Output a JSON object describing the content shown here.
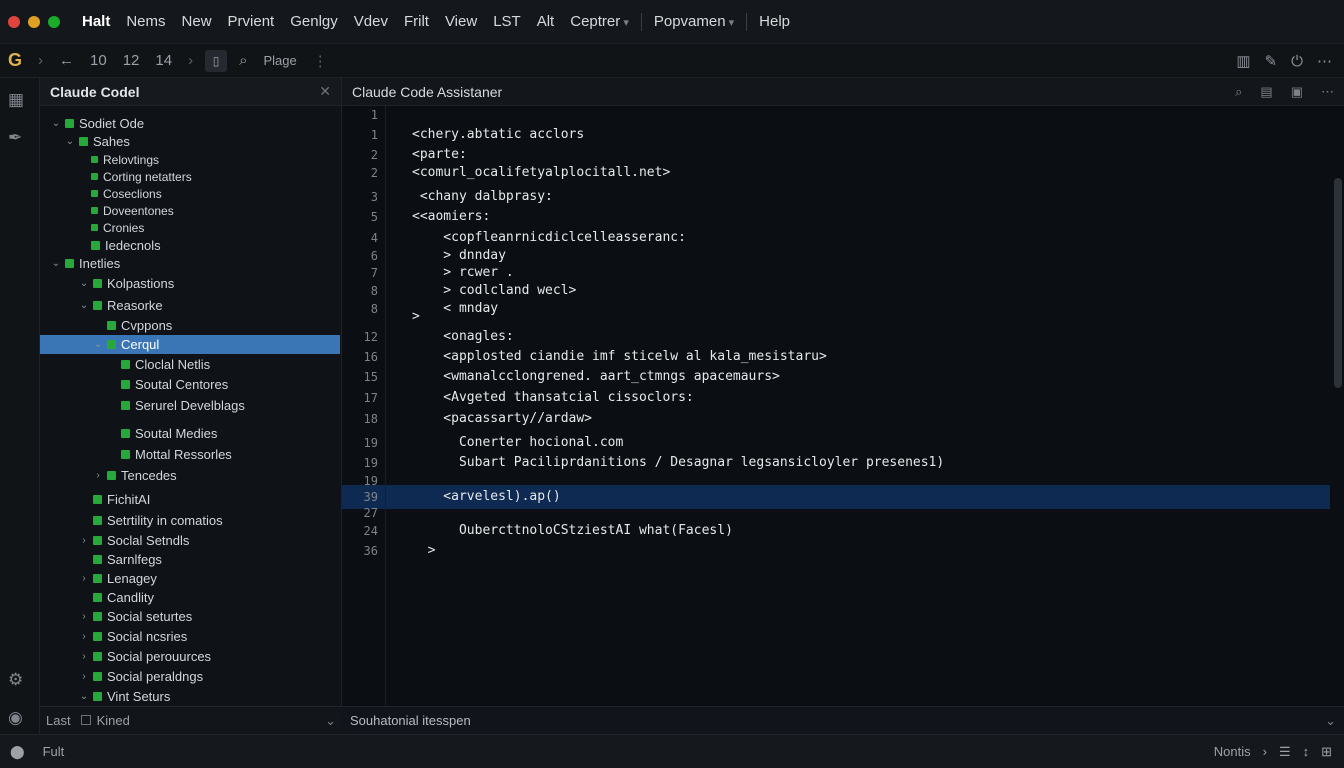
{
  "menubar": {
    "colors": {
      "close": "#e0443e",
      "minimize": "#dea123",
      "zoom": "#1aab29"
    },
    "items": [
      "Halt",
      "Nems",
      "New",
      "Prvient",
      "Genlgy",
      "Vdev",
      "Frilt",
      "View",
      "LST",
      "Alt",
      "Ceptrer",
      "Popvamen",
      "Help"
    ]
  },
  "toolbar": {
    "logo": "G",
    "nav_numbers": [
      "10",
      "12",
      "14"
    ],
    "page_label": "Plage",
    "icons": [
      "chevron-right-icon",
      "back-arrow-icon",
      "forward-arrow-icon",
      "document-icon",
      "search-icon",
      "more-icon",
      "columns-icon",
      "brush-icon",
      "power-icon",
      "ellipsis-icon"
    ]
  },
  "activity": {
    "icons": [
      "grid-icon",
      "pen-icon",
      "settings-icon",
      "account-icon"
    ]
  },
  "explorer": {
    "title": "Claude Codel",
    "rows": [
      {
        "label": "Sodiet Ode",
        "chev": "v"
      },
      {
        "label": "Sahes",
        "chev": "v"
      },
      {
        "label": "Relovtings",
        "chev": ""
      },
      {
        "label": "Corting netatters",
        "chev": ""
      },
      {
        "label": "Coseclions",
        "chev": ""
      },
      {
        "label": "Doveentones",
        "chev": ""
      },
      {
        "label": "Cronies",
        "chev": ""
      },
      {
        "label": "Iedecnols",
        "chev": ""
      },
      {
        "label": "Inetlies",
        "chev": "v"
      },
      {
        "label": "Kolpastions",
        "chev": "v"
      },
      {
        "label": "Reasorke",
        "chev": "v"
      },
      {
        "label": "Cvppons",
        "chev": ""
      },
      {
        "label": "Cerqul",
        "chev": "v"
      },
      {
        "label": "Cloclal Netlis",
        "chev": ""
      },
      {
        "label": "Soutal Centores",
        "chev": ""
      },
      {
        "label": "Serurel Develblags",
        "chev": ""
      },
      {
        "label": "Soutal Medies",
        "chev": ""
      },
      {
        "label": "Mottal Ressorles",
        "chev": ""
      },
      {
        "label": "Tencedes",
        "chev": ">"
      },
      {
        "label": "FichitAI",
        "chev": ""
      },
      {
        "label": "Setrtility in comatios",
        "chev": ""
      },
      {
        "label": "Soclal Setndls",
        "chev": ">"
      },
      {
        "label": "Sarnlfegs",
        "chev": ""
      },
      {
        "label": "Lenagey",
        "chev": ">"
      },
      {
        "label": "Candlity",
        "chev": ""
      },
      {
        "label": "Social seturtes",
        "chev": ">"
      },
      {
        "label": "Social ncsries",
        "chev": ">"
      },
      {
        "label": "Social perouurces",
        "chev": ">"
      },
      {
        "label": "Social peraldngs",
        "chev": ">"
      },
      {
        "label": "Vint Seturs",
        "chev": "v"
      }
    ],
    "footer": {
      "left": "Last",
      "checkbox_label": "Kined"
    }
  },
  "editor": {
    "title": "Claude Code Assistaner",
    "lines": [
      {
        "n": "1",
        "code": ""
      },
      {
        "n": "1",
        "code": "<chery.abtatic acclors"
      },
      {
        "n": "2",
        "code": "<parte:"
      },
      {
        "n": "2",
        "code": "<comurl_ocalifetyalplocitall.net>"
      },
      {
        "n": "3",
        "code": " <chany dalbprasy:"
      },
      {
        "n": "5",
        "code": "<<aomiers:"
      },
      {
        "n": "4",
        "code": "    <copfleanrnicdiclcelleasseranc:"
      },
      {
        "n": "6",
        "code": "    > dnnday"
      },
      {
        "n": "7",
        "code": "    > rcwer ."
      },
      {
        "n": "8",
        "code": "    > codlcland wecl>"
      },
      {
        "n": "8",
        "code": "    < mnday"
      },
      {
        "n": "",
        "code": ">"
      },
      {
        "n": "12",
        "code": "    <onagles:"
      },
      {
        "n": "16",
        "code": "    <applosted ciandie imf sticelw al kala_mesistaru>"
      },
      {
        "n": "15",
        "code": "    <wmanalcclongrened. aart_ctmngs apacemaurs>"
      },
      {
        "n": "17",
        "code": "    <Avgeted thansatcial cissoclors:"
      },
      {
        "n": "18",
        "code": "    <pacassarty//ardaw>"
      },
      {
        "n": "19",
        "code": "      Conerter hocional.com"
      },
      {
        "n": "19",
        "code": "      Subart Paciliprdanitions / Desagnar legsansicloyler presenes1)"
      },
      {
        "n": "19",
        "code": ""
      },
      {
        "n": "39",
        "code": "    <arvelesl).ap()"
      },
      {
        "n": "27",
        "code": ""
      },
      {
        "n": "24",
        "code": "      OubercttnoloCStziestAI what(Facesl)"
      },
      {
        "n": "36",
        "code": "  >"
      }
    ],
    "footer": "Souhatonial itesspen",
    "icons": [
      "search-icon",
      "split-icon",
      "save-icon",
      "more-icon"
    ]
  },
  "statusbar": {
    "left_label": "Fult",
    "right_label": "Nontis",
    "right_icons": [
      "list-icon",
      "sync-icon",
      "layout-icon"
    ]
  }
}
